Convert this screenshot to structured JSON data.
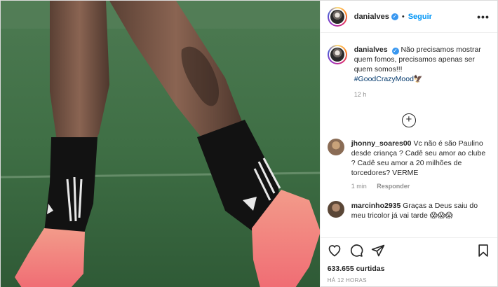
{
  "header": {
    "username": "danialves",
    "separator": "•",
    "follow_label": "Seguir",
    "more_label": "•••"
  },
  "caption": {
    "username": "danialves",
    "text": "Não precisamos mostrar quem fomos, precisamos apenas ser quem somos!!!",
    "hashtag": "#GoodCrazyMood🦅",
    "time": "12 h"
  },
  "load_more_symbol": "+",
  "comments": [
    {
      "username": "jhonny_soares00",
      "text": "Vc não é são Paulino desde criança ? Cadê seu amor ao clube ? Cadê seu amor a 20 milhões de torcedores? VERME",
      "time": "1 min",
      "reply_label": "Responder"
    },
    {
      "username": "marcinho2935",
      "text": "Graças a Deus saiu do meu tricolor já vai tarde 😱😱😱"
    }
  ],
  "footer": {
    "likes": "633.655 curtidas",
    "time": "HÁ 12 HORAS"
  },
  "icons": {
    "verified": "verified-badge-icon",
    "like": "heart-icon",
    "comment": "comment-icon",
    "share": "share-icon",
    "save": "bookmark-icon"
  },
  "colors": {
    "link_blue": "#0095f6",
    "verified_blue": "#3897f0",
    "hashtag": "#00376b",
    "muted": "#8e8e8e"
  }
}
